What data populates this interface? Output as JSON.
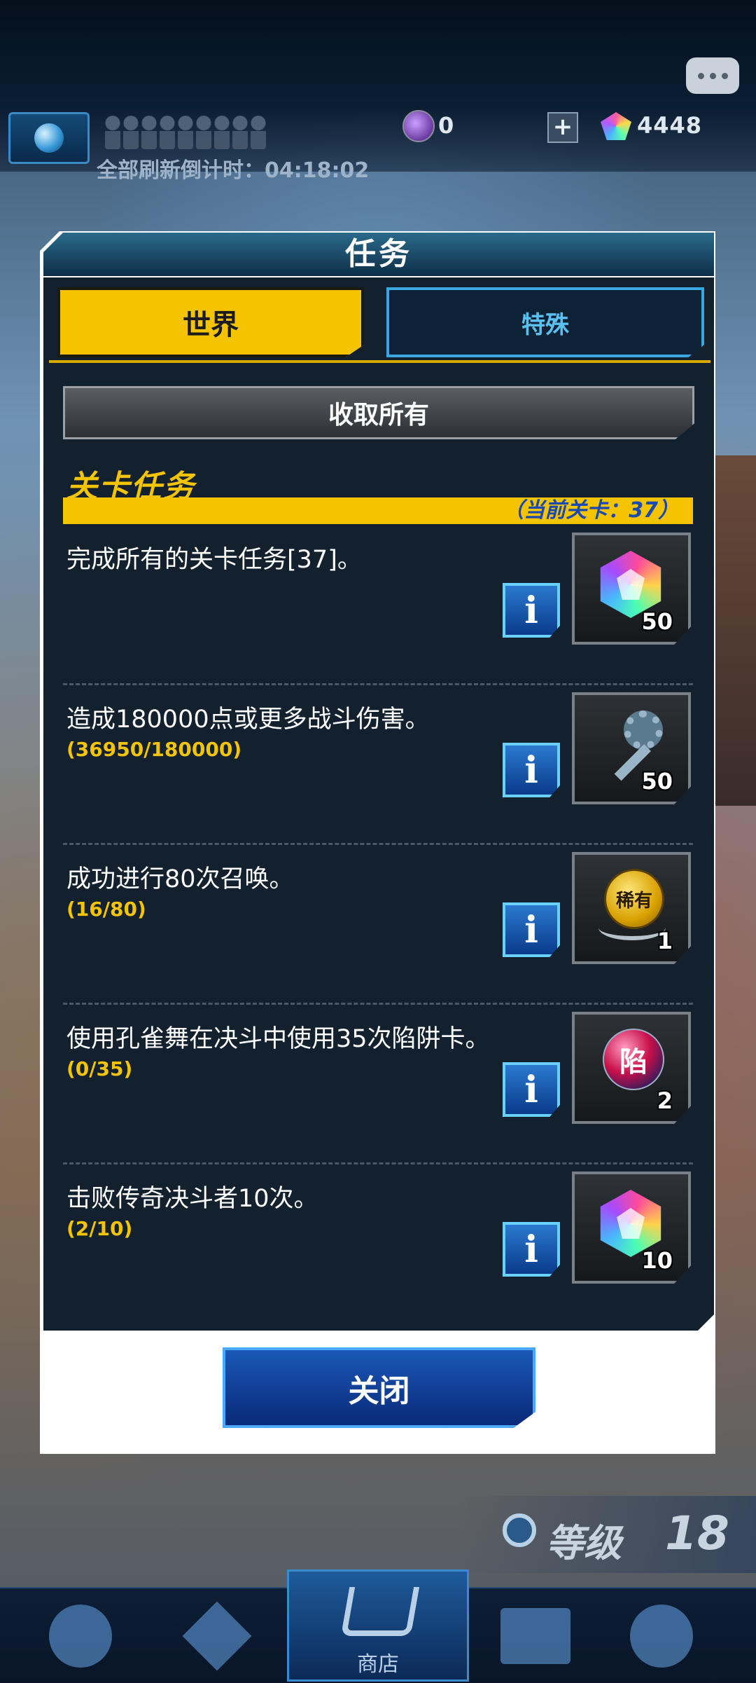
{
  "top_bar": {
    "refresh_countdown": "全部刷新倒计时：04:18:02",
    "orb_count": "0",
    "gem_count": "4448"
  },
  "dialog": {
    "title": "任务",
    "tabs": [
      {
        "label": "世界",
        "active": true
      },
      {
        "label": "特殊",
        "active": false
      }
    ],
    "collect_all_label": "收取所有",
    "section_title": "关卡任务",
    "section_subtitle": "（当前关卡：37）",
    "missions": [
      {
        "description": "完成所有的关卡任务[37]。",
        "progress": "",
        "reward_icon": "gem-icon",
        "reward_qty": "50"
      },
      {
        "description": "造成180000点或更多战斗伤害。",
        "progress": "(36950/180000)",
        "reward_icon": "key-icon",
        "reward_qty": "50"
      },
      {
        "description": "成功进行80次召唤。",
        "progress": "(16/80)",
        "reward_icon": "rare-medal-icon",
        "reward_qty": "1"
      },
      {
        "description": "使用孔雀舞在决斗中使用35次陷阱卡。",
        "progress": "(0/35)",
        "reward_icon": "trap-orb-icon",
        "reward_qty": "2"
      },
      {
        "description": "击败传奇决斗者10次。",
        "progress": "(2/10)",
        "reward_icon": "gem-icon",
        "reward_qty": "10"
      }
    ],
    "info_label": "i",
    "medal_text": "稀有",
    "orb_text": "陷",
    "close_label": "关闭"
  },
  "footer": {
    "level_label": "等级",
    "level_value": "18",
    "shop_label": "商店"
  },
  "colors": {
    "accent_yellow": "#f5c400",
    "panel_bg": "#13212f",
    "tab_inactive_border": "#3aa8e0",
    "progress_text": "#f5c400"
  }
}
